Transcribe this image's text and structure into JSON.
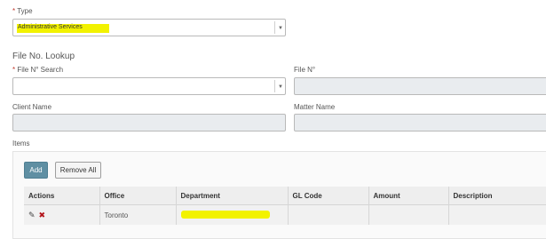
{
  "type_field": {
    "label_marker": "*",
    "label": "Type",
    "value": "Administrative Services"
  },
  "file_lookup": {
    "title": "File No. Lookup",
    "file_search_marker": "*",
    "file_search_label": "File N° Search",
    "file_no_label": "File N°",
    "client_name_label": "Client Name",
    "matter_name_label": "Matter Name"
  },
  "items": {
    "label": "Items",
    "add_label": "Add",
    "remove_all_label": "Remove All",
    "columns": [
      "Actions",
      "Office",
      "Department",
      "GL Code",
      "Amount",
      "Description"
    ],
    "rows": [
      {
        "office": "Toronto",
        "department": "",
        "gl_code": "",
        "amount": "",
        "description": ""
      }
    ]
  },
  "icons": {
    "edit": "pencil-icon",
    "delete": "close-icon",
    "dropdown": "chevron-down-icon"
  },
  "colors": {
    "highlight": "#f2f200",
    "required": "#c0392b",
    "primary_button": "#5f8fa3"
  }
}
